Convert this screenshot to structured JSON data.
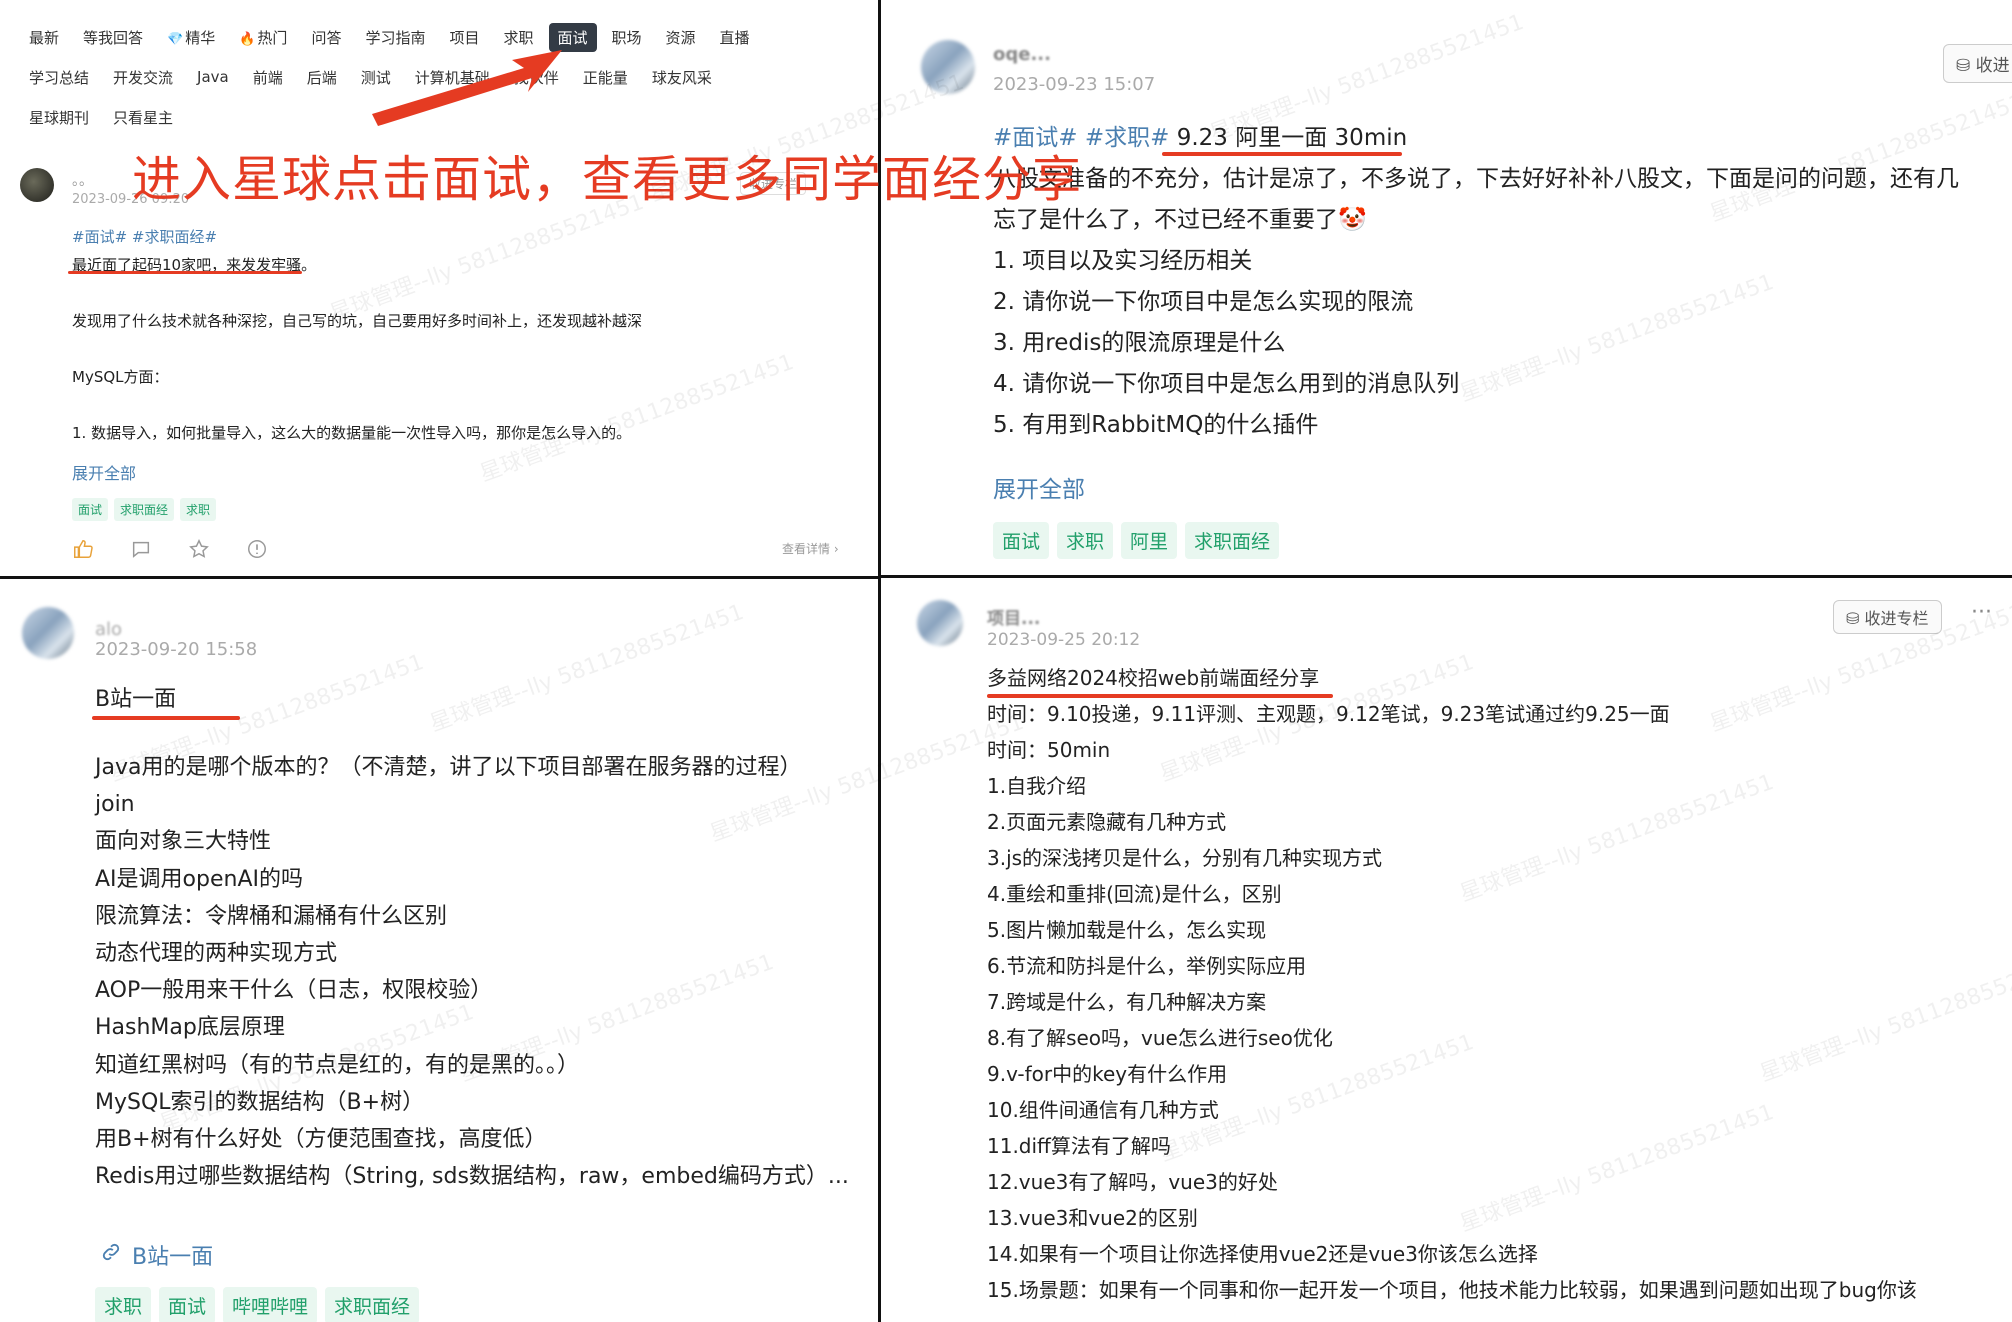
{
  "overlay": {
    "instruction": "进入星球点击面试，查看更多同学面经分享"
  },
  "q1": {
    "tabs_row1": [
      {
        "label": "最新",
        "icon": ""
      },
      {
        "label": "等我回答",
        "icon": ""
      },
      {
        "label": "精华",
        "icon": "💎"
      },
      {
        "label": "热门",
        "icon": "🔥"
      },
      {
        "label": "问答",
        "icon": ""
      },
      {
        "label": "学习指南",
        "icon": ""
      },
      {
        "label": "项目",
        "icon": ""
      },
      {
        "label": "求职",
        "icon": ""
      },
      {
        "label": "面试",
        "icon": "",
        "active": true
      },
      {
        "label": "职场",
        "icon": ""
      },
      {
        "label": "资源",
        "icon": ""
      },
      {
        "label": "直播",
        "icon": ""
      }
    ],
    "tabs_row2": [
      {
        "label": "学习总结"
      },
      {
        "label": "开发交流"
      },
      {
        "label": "Java"
      },
      {
        "label": "前端"
      },
      {
        "label": "后端"
      },
      {
        "label": "测试"
      },
      {
        "label": "计算机基础"
      },
      {
        "label": "找伙伴"
      },
      {
        "label": "正能量"
      },
      {
        "label": "球友风采"
      }
    ],
    "tabs_row3": [
      {
        "label": "星球期刊"
      },
      {
        "label": "只看星主"
      }
    ],
    "post": {
      "author": "。。",
      "date": "2023-09-26 09:20",
      "collect_label": "收进专栏",
      "hashtags": "#面试# #求职面经#",
      "lines": [
        "最近面了起码10家吧，来发发牢骚。",
        "发现用了什么技术就各种深挖，自己写的坑，自己要用好多时间补上，还发现越补越深",
        "MySQL方面：",
        "1. 数据导入，如何批量导入，这么大的数据量能一次性导入吗，那你是怎么导入的。"
      ],
      "expand_label": "展开全部",
      "tags": [
        "面试",
        "求职面经",
        "求职"
      ],
      "detail_label": "查看详情"
    }
  },
  "q2": {
    "author": "oqe...",
    "date": "2023-09-23 15:07",
    "collect_label": "收进",
    "hashtags": "#面试# #求职#",
    "title": "9.23 阿里一面 30min",
    "lines": [
      "八股文准备的不充分，估计是凉了，不多说了，下去好好补补八股文，下面是问的问题，还有几",
      "忘了是什么了，不过已经不重要了🤡",
      "1. 项目以及实习经历相关",
      "2. 请你说一下你项目中是怎么实现的限流",
      "3. 用redis的限流原理是什么",
      "4. 请你说一下你项目中是怎么用到的消息队列",
      "5. 有用到RabbitMQ的什么插件"
    ],
    "expand_label": "展开全部",
    "tags": [
      "面试",
      "求职",
      "阿里",
      "求职面经"
    ]
  },
  "q3": {
    "author": "alo",
    "date": "2023-09-20 15:58",
    "title": "B站一面",
    "lines": [
      "Java用的是哪个版本的？（不清楚，讲了以下项目部署在服务器的过程）",
      "join",
      "面向对象三大特性",
      "AI是调用openAI的吗",
      "限流算法：令牌桶和漏桶有什么区别",
      "动态代理的两种实现方式",
      "AOP一般用来干什么（日志，权限校验）",
      "HashMap底层原理",
      "知道红黑树吗（有的节点是红的，有的是黑的。。）",
      "MySQL索引的数据结构（B+树）",
      "用B+树有什么好处（方便范围查找，高度低）",
      "Redis用过哪些数据结构（String, sds数据结构，raw，embed编码方式）..."
    ],
    "link_label": "B站一面",
    "tags": [
      "求职",
      "面试",
      "哔哩哔哩",
      "求职面经"
    ]
  },
  "q4": {
    "author": "项目...",
    "date": "2023-09-25 20:12",
    "collect_label": "收进专栏",
    "more_label": "···",
    "title": "多益网络2024校招web前端面经分享",
    "lines": [
      "时间：9.10投递，9.11评测、主观题，9.12笔试，9.23笔试通过约9.25一面",
      "时间：50min",
      "1.自我介绍",
      "2.页面元素隐藏有几种方式",
      "3.js的深浅拷贝是什么，分别有几种实现方式",
      "4.重绘和重排(回流)是什么，区别",
      "5.图片懒加载是什么，怎么实现",
      "6.节流和防抖是什么，举例实际应用",
      "7.跨域是什么，有几种解决方案",
      "8.有了解seo吗，vue怎么进行seo优化",
      "9.v-for中的key有什么作用",
      "10.组件间通信有几种方式",
      "11.diff算法有了解吗",
      "12.vue3有了解吗，vue3的好处",
      "13.vue3和vue2的区别",
      "14.如果有一个项目让你选择使用vue2还是vue3你该怎么选择",
      "15.场景题：如果有一个同事和你一起开发一个项目，他技术能力比较弱，如果遇到问题如出现了bug你该"
    ]
  },
  "watermark": "星球管理--lly 58112885521451",
  "colors": {
    "accent_red": "#e53b22",
    "link_blue": "#4a7fb0",
    "tag_green": "#22a06b",
    "tab_active_bg": "#333b45"
  }
}
